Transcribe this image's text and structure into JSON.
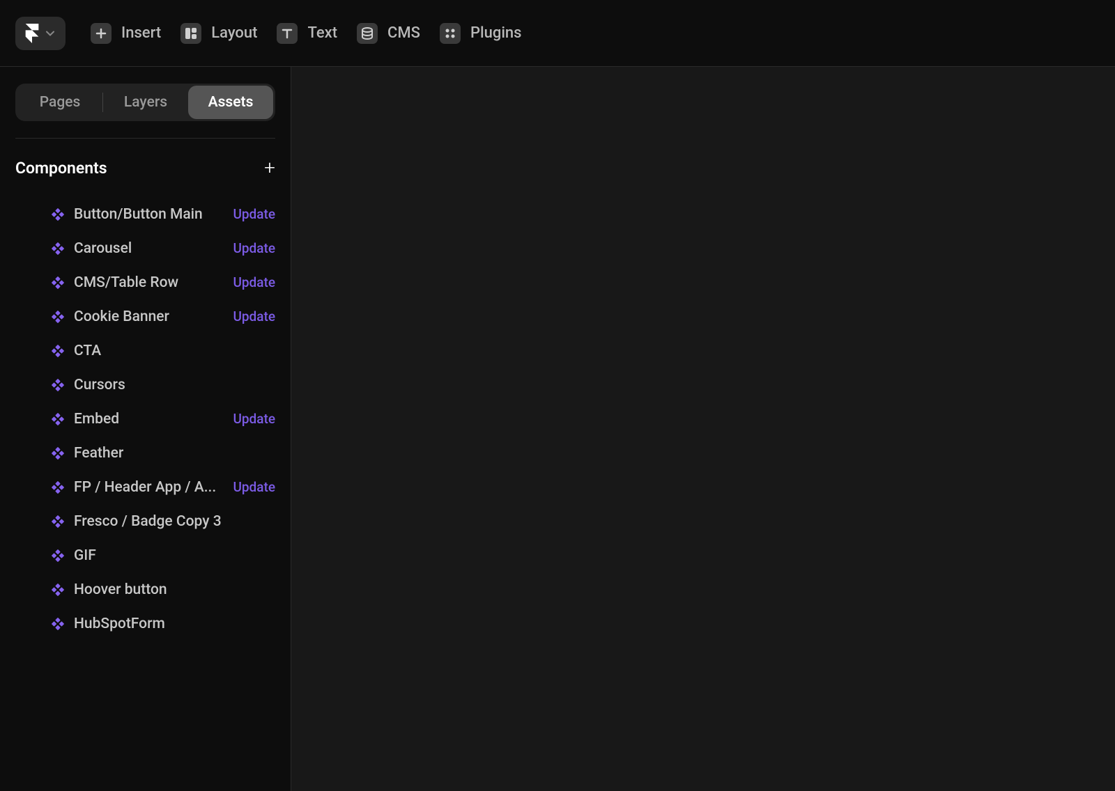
{
  "topbar": {
    "items": [
      {
        "label": "Insert",
        "icon": "plus"
      },
      {
        "label": "Layout",
        "icon": "layout"
      },
      {
        "label": "Text",
        "icon": "text"
      },
      {
        "label": "CMS",
        "icon": "stack"
      },
      {
        "label": "Plugins",
        "icon": "plugins"
      }
    ]
  },
  "sidebar": {
    "tabs": [
      {
        "label": "Pages",
        "active": false
      },
      {
        "label": "Layers",
        "active": false
      },
      {
        "label": "Assets",
        "active": true
      }
    ],
    "section_title": "Components",
    "update_label": "Update",
    "components": [
      {
        "name": "Button/Button Main",
        "update": true
      },
      {
        "name": "Carousel",
        "update": true
      },
      {
        "name": "CMS/Table Row",
        "update": true
      },
      {
        "name": "Cookie Banner",
        "update": true
      },
      {
        "name": "CTA",
        "update": false
      },
      {
        "name": "Cursors",
        "update": false
      },
      {
        "name": "Embed",
        "update": true
      },
      {
        "name": "Feather",
        "update": false
      },
      {
        "name": "FP / Header App / A...",
        "update": true
      },
      {
        "name": "Fresco / Badge Copy 3",
        "update": false
      },
      {
        "name": "GIF",
        "update": false
      },
      {
        "name": "Hoover button",
        "update": false
      },
      {
        "name": "HubSpotForm",
        "update": false
      }
    ]
  },
  "colors": {
    "accent": "#8663f0",
    "link": "#7c5ce6"
  }
}
